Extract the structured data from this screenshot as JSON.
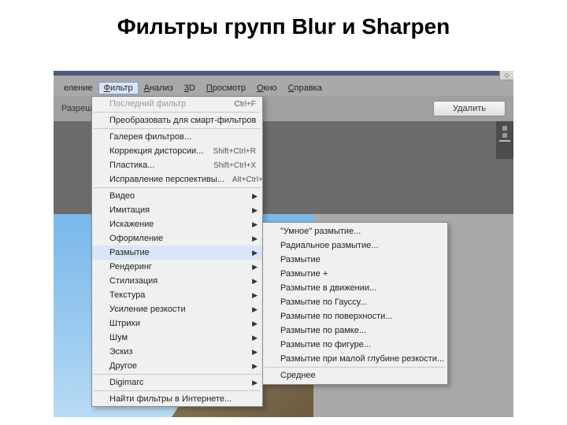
{
  "slide_title": "Фильтры групп Blur и Sharpen",
  "menubar": {
    "items": [
      {
        "label": "еление",
        "active": false
      },
      {
        "label": "Фильтр",
        "active": true
      },
      {
        "label": "Анализ",
        "active": false
      },
      {
        "label": "3D",
        "active": false
      },
      {
        "label": "Просмотр",
        "active": false
      },
      {
        "label": "Окно",
        "active": false
      },
      {
        "label": "Справка",
        "active": false
      }
    ]
  },
  "toolbar": {
    "left_label": "Разрешени",
    "delete_label": "Удалить"
  },
  "corner_glyph": "◇",
  "dropdown": [
    {
      "type": "item",
      "label": "Последний фильтр",
      "shortcut": "Ctrl+F",
      "disabled": true
    },
    {
      "type": "sep"
    },
    {
      "type": "item",
      "label": "Преобразовать для смарт-фильтров"
    },
    {
      "type": "sep"
    },
    {
      "type": "item",
      "label": "Галерея фильтров..."
    },
    {
      "type": "item",
      "label": "Коррекция дисторсии...",
      "shortcut": "Shift+Ctrl+R"
    },
    {
      "type": "item",
      "label": "Пластика...",
      "shortcut": "Shift+Ctrl+X"
    },
    {
      "type": "item",
      "label": "Исправление перспективы...",
      "shortcut": "Alt+Ctrl+V"
    },
    {
      "type": "sep"
    },
    {
      "type": "item",
      "label": "Видео",
      "submenu": true
    },
    {
      "type": "item",
      "label": "Имитация",
      "submenu": true
    },
    {
      "type": "item",
      "label": "Искажение",
      "submenu": true
    },
    {
      "type": "item",
      "label": "Оформление",
      "submenu": true
    },
    {
      "type": "item",
      "label": "Размытие",
      "submenu": true,
      "selected": true
    },
    {
      "type": "item",
      "label": "Рендеринг",
      "submenu": true
    },
    {
      "type": "item",
      "label": "Стилизация",
      "submenu": true
    },
    {
      "type": "item",
      "label": "Текстура",
      "submenu": true
    },
    {
      "type": "item",
      "label": "Усиление резкости",
      "submenu": true
    },
    {
      "type": "item",
      "label": "Штрихи",
      "submenu": true
    },
    {
      "type": "item",
      "label": "Шум",
      "submenu": true
    },
    {
      "type": "item",
      "label": "Эскиз",
      "submenu": true
    },
    {
      "type": "item",
      "label": "Другое",
      "submenu": true
    },
    {
      "type": "sep"
    },
    {
      "type": "item",
      "label": "Digimarc",
      "submenu": true
    },
    {
      "type": "sep"
    },
    {
      "type": "item",
      "label": "Найти фильтры в Интернете..."
    }
  ],
  "submenu": [
    {
      "type": "item",
      "label": "\"Умное\" размытие..."
    },
    {
      "type": "item",
      "label": "Радиальное размытие..."
    },
    {
      "type": "item",
      "label": "Размытие"
    },
    {
      "type": "item",
      "label": "Размытие +"
    },
    {
      "type": "item",
      "label": "Размытие в движении..."
    },
    {
      "type": "item",
      "label": "Размытие по Гауссу..."
    },
    {
      "type": "item",
      "label": "Размытие по поверхности..."
    },
    {
      "type": "item",
      "label": "Размытие по рамке..."
    },
    {
      "type": "item",
      "label": "Размытие по фигуре..."
    },
    {
      "type": "item",
      "label": "Размытие при малой глубине резкости..."
    },
    {
      "type": "sep"
    },
    {
      "type": "item",
      "label": "Среднее"
    }
  ]
}
